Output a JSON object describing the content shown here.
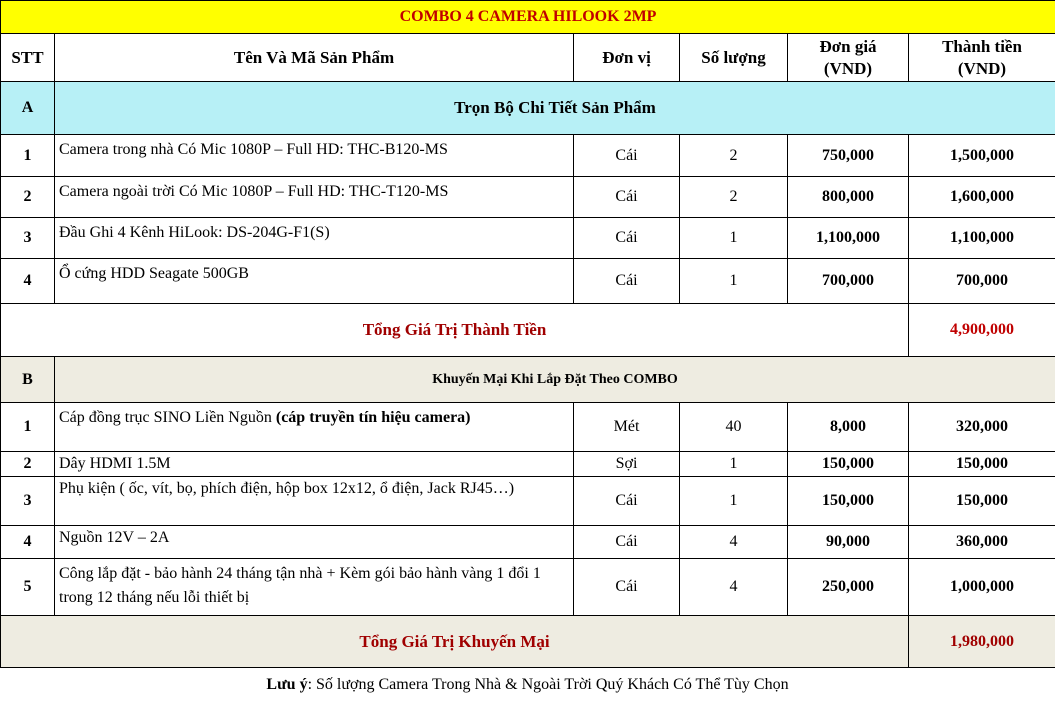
{
  "title": "COMBO 4 CAMERA HILOOK 2MP",
  "headers": {
    "stt": "STT",
    "name": "Tên Và Mã Sản Phẩm",
    "unit": "Đơn vị",
    "qty": "Số lượng",
    "price_line1": "Đơn giá",
    "price_line2": "(VND)",
    "total_line1": "Thành tiền",
    "total_line2": "(VND)"
  },
  "section_a": {
    "code": "A",
    "title": "Trọn Bộ Chi Tiết Sản Phẩm",
    "items": [
      {
        "stt": "1",
        "name": "Camera trong nhà Có Mic  1080P – Full HD: THC-B120-MS",
        "unit": "Cái",
        "qty": "2",
        "price": "750,000",
        "total": "1,500,000"
      },
      {
        "stt": "2",
        "name": "Camera ngoài trời Có Mic 1080P – Full HD: THC-T120-MS",
        "unit": "Cái",
        "qty": "2",
        "price": "800,000",
        "total": "1,600,000"
      },
      {
        "stt": "3",
        "name": "Đầu Ghi 4 Kênh  HiLook: DS-204G-F1(S)",
        "unit": "Cái",
        "qty": "1",
        "price": "1,100,000",
        "total": "1,100,000"
      },
      {
        "stt": "4",
        "name": "Ổ cứng HDD Seagate 500GB",
        "unit": "Cái",
        "qty": "1",
        "price": "700,000",
        "total": "700,000"
      }
    ],
    "total_label": "Tổng Giá Trị Thành Tiền",
    "total_value": "4,900,000"
  },
  "section_b": {
    "code": "B",
    "title": "Khuyến Mại Khi Lắp Đặt Theo COMBO",
    "items": [
      {
        "stt": "1",
        "name": "Cáp đồng trục SINO Liền Nguồn ",
        "name_bold": "(cáp truyền tín hiệu camera)",
        "unit": "Mét",
        "qty": "40",
        "price": "8,000",
        "total": "320,000"
      },
      {
        "stt": "2",
        "name": "Dây HDMI 1.5M",
        "unit": "Sợi",
        "qty": "1",
        "price": "150,000",
        "total": "150,000"
      },
      {
        "stt": "3",
        "name": "Phụ kiện ( ốc, vít, bọ, phích điện, hộp box 12x12, ổ điện, Jack RJ45…)",
        "unit": "Cái",
        "qty": "1",
        "price": "150,000",
        "total": "150,000"
      },
      {
        "stt": "4",
        "name": "Nguồn 12V – 2A",
        "unit": "Cái",
        "qty": "4",
        "price": "90,000",
        "total": "360,000"
      },
      {
        "stt": "5",
        "name": "Công lắp đặt - bảo hành 24 tháng tận nhà + Kèm gói bảo hành vàng 1 đổi 1 trong 12 tháng nếu lỗi thiết bị",
        "unit": "Cái",
        "qty": "4",
        "price": "250,000",
        "total": "1,000,000"
      }
    ],
    "total_label": "Tổng Giá Trị Khuyến Mại",
    "total_value": "1,980,000"
  },
  "note": {
    "label": "Lưu ý",
    "text": ": Số lượng Camera Trong Nhà & Ngoài Trời Quý Khách Có Thể Tùy Chọn"
  }
}
